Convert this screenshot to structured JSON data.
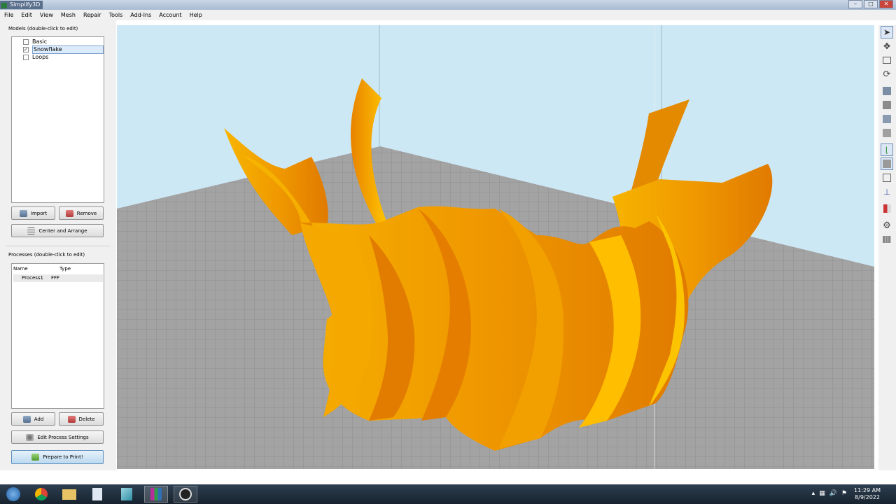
{
  "window": {
    "title": "Simplify3D",
    "buttons": [
      "–",
      "□",
      "✕"
    ]
  },
  "menu": [
    "File",
    "Edit",
    "View",
    "Mesh",
    "Repair",
    "Tools",
    "Add-Ins",
    "Account",
    "Help"
  ],
  "models": {
    "label": "Models (double-click to edit)",
    "items": [
      {
        "name": "Basic",
        "checked": false,
        "selected": false
      },
      {
        "name": "Snowflake",
        "checked": true,
        "selected": true
      },
      {
        "name": "Loops",
        "checked": false,
        "selected": false
      }
    ],
    "import_label": "Import",
    "remove_label": "Remove",
    "center_label": "Center and Arrange"
  },
  "processes": {
    "label": "Processes (double-click to edit)",
    "col_name": "Name",
    "col_type": "Type",
    "rows": [
      {
        "name": "Process1",
        "type": "FFF"
      }
    ],
    "add_label": "Add",
    "delete_label": "Delete",
    "edit_label": "Edit Process Settings",
    "prepare_label": "Prepare to Print!"
  },
  "toolbar_icons": [
    "select-icon",
    "move-icon",
    "scale-icon",
    "rotate-icon",
    "view-iso-icon",
    "view-front-icon",
    "view-top-icon",
    "view-side-icon",
    "axes-icon",
    "cube-icon",
    "wireframe-icon",
    "axis-z-icon",
    "cross-section-icon",
    "gear-icon",
    "multi-view-icon"
  ],
  "taskbar": {
    "icons": [
      "windows-start-icon",
      "chrome-icon",
      "file-explorer-icon",
      "notepad-icon",
      "pen-app-icon",
      "simplify3d-taskbar-icon",
      "obs-icon"
    ],
    "time": "11:29 AM",
    "date": "8/9/2022"
  },
  "colors": {
    "model_orange": "#f0a000",
    "viewport_sky": "#cde8f5",
    "bed_gray": "#9a9a9a"
  }
}
